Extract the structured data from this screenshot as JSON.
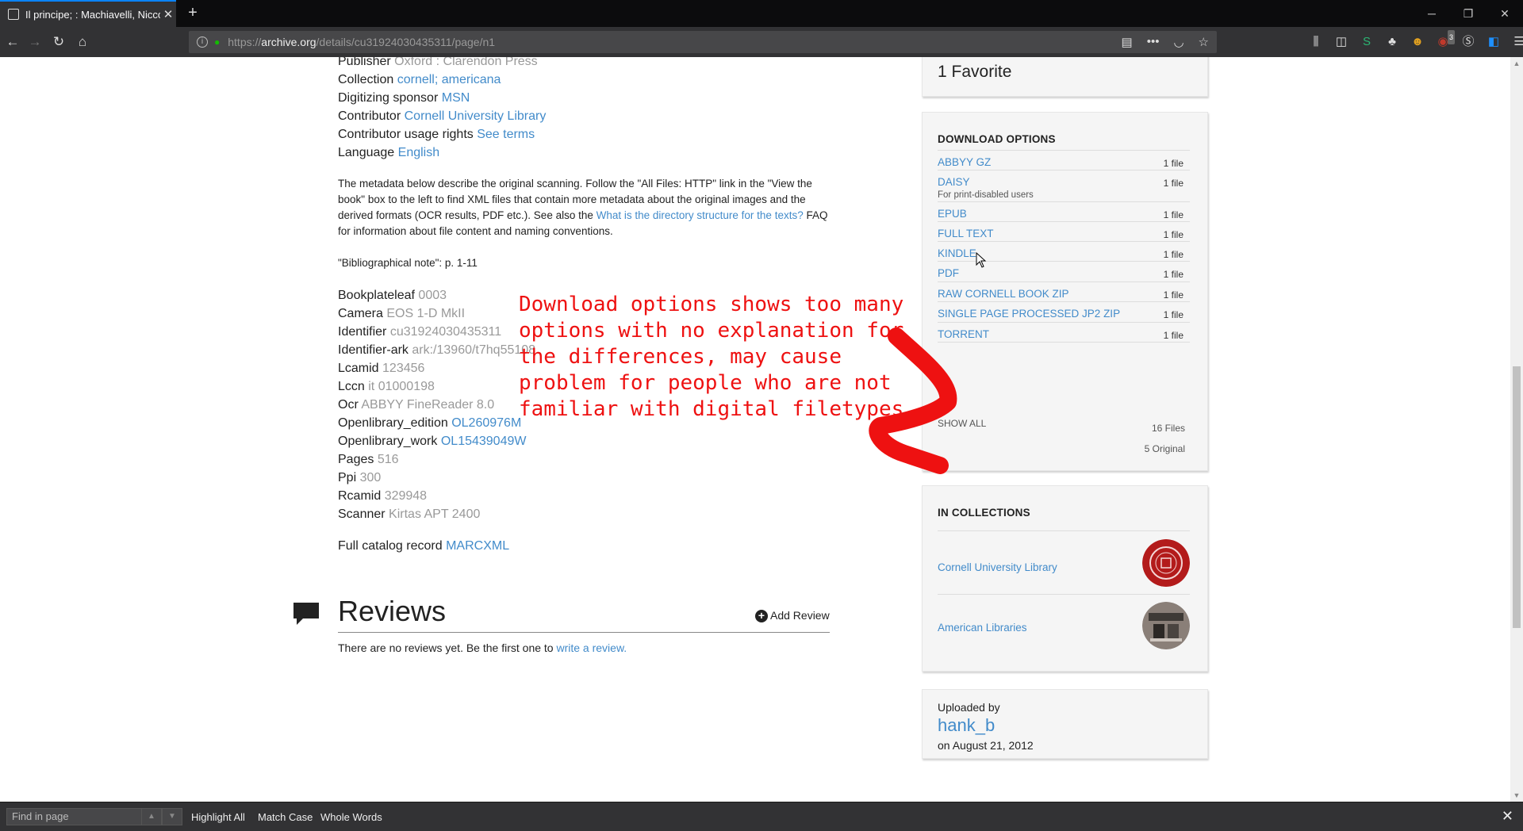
{
  "browser": {
    "tab_title": "Il principe; : Machiavelli, Niccolò",
    "url_prefix": "https://",
    "url_domain": "archive.org",
    "url_path": "/details/cu31924030435311/page/n1",
    "close_glyph": "✕",
    "newtab_glyph": "+",
    "win_minimize": "─",
    "win_restore": "❐",
    "win_close": "✕",
    "back_glyph": "←",
    "forward_glyph": "→",
    "reload_glyph": "↻",
    "home_glyph": "⌂",
    "badge_count": "3"
  },
  "metadata_top": [
    {
      "key": "Publisher",
      "value": "Oxford : Clarendon Press",
      "link": false
    },
    {
      "key": "Collection",
      "value": "cornell; americana",
      "link": true
    },
    {
      "key": "Digitizing sponsor",
      "value": "MSN",
      "link": true
    },
    {
      "key": "Contributor",
      "value": "Cornell University Library",
      "link": true
    },
    {
      "key": "Contributor usage rights",
      "value": "See terms",
      "link": true
    },
    {
      "key": "Language",
      "value": "English",
      "link": true
    }
  ],
  "scan_note": {
    "text_before": "The metadata below describe the original scanning. Follow the \"All Files: HTTP\" link in the \"View the book\" box to the left to find XML files that contain more metadata about the original images and the derived formats (OCR results, PDF etc.). See also the ",
    "link": "What is the directory structure for the texts?",
    "text_after": " FAQ for information about file content and naming conventions."
  },
  "bibliographical_note": "\"Bibliographical note\": p. 1-11",
  "metadata_scan": [
    {
      "key": "Bookplateleaf",
      "value": "0003",
      "link": false
    },
    {
      "key": "Camera",
      "value": "EOS 1-D MkII",
      "link": false
    },
    {
      "key": "Identifier",
      "value": "cu31924030435311",
      "link": false
    },
    {
      "key": "Identifier-ark",
      "value": "ark:/13960/t7hq55108",
      "link": false
    },
    {
      "key": "Lcamid",
      "value": "123456",
      "link": false
    },
    {
      "key": "Lccn",
      "value": "it 01000198",
      "link": false
    },
    {
      "key": "Ocr",
      "value": "ABBYY FineReader 8.0",
      "link": false
    },
    {
      "key": "Openlibrary_edition",
      "value": "OL260976M",
      "link": true
    },
    {
      "key": "Openlibrary_work",
      "value": "OL15439049W",
      "link": true
    },
    {
      "key": "Pages",
      "value": "516",
      "link": false
    },
    {
      "key": "Ppi",
      "value": "300",
      "link": false
    },
    {
      "key": "Rcamid",
      "value": "329948",
      "link": false
    },
    {
      "key": "Scanner",
      "value": "Kirtas APT 2400",
      "link": false
    }
  ],
  "catalog": {
    "label": "Full catalog record",
    "link": "MARCXML"
  },
  "reviews": {
    "title": "Reviews",
    "add_label": "Add Review",
    "add_glyph": "+",
    "empty_text": "There are no reviews yet. Be the first one to ",
    "empty_link": "write a review."
  },
  "favorites": {
    "label": "1 Favorite"
  },
  "download": {
    "title": "DOWNLOAD OPTIONS",
    "items": [
      {
        "name": "ABBYY GZ",
        "count": "1 file",
        "sub": ""
      },
      {
        "name": "DAISY",
        "count": "1 file",
        "sub": "For print-disabled users"
      },
      {
        "name": "EPUB",
        "count": "1 file",
        "sub": ""
      },
      {
        "name": "FULL TEXT",
        "count": "1 file",
        "sub": ""
      },
      {
        "name": "KINDLE",
        "count": "1 file",
        "sub": ""
      },
      {
        "name": "PDF",
        "count": "1 file",
        "sub": ""
      },
      {
        "name": "RAW CORNELL BOOK ZIP",
        "count": "1 file",
        "sub": ""
      },
      {
        "name": "SINGLE PAGE PROCESSED JP2 ZIP",
        "count": "1 file",
        "sub": ""
      },
      {
        "name": "TORRENT",
        "count": "1 file",
        "sub": ""
      }
    ],
    "show_all": "SHOW ALL",
    "total_files": "16 Files",
    "original": "5 Original"
  },
  "collections": {
    "title": "IN COLLECTIONS",
    "items": [
      {
        "name": "Cornell University Library"
      },
      {
        "name": "American Libraries"
      }
    ]
  },
  "uploader": {
    "label": "Uploaded by",
    "name": "hank_b",
    "date": "on August 21, 2012"
  },
  "annotation": {
    "text": "Download options shows too many options with no explanation for the differences, may cause problem for people who are not familiar with digital filetypes",
    "color": "#ee1111"
  },
  "findbar": {
    "placeholder": "Find in page",
    "highlight_all": "Highlight All",
    "match_case": "Match Case",
    "whole_words": "Whole Words",
    "close_glyph": "✕"
  },
  "colors": {
    "link": "#428bca",
    "accent_tab": "#0a84ff"
  }
}
